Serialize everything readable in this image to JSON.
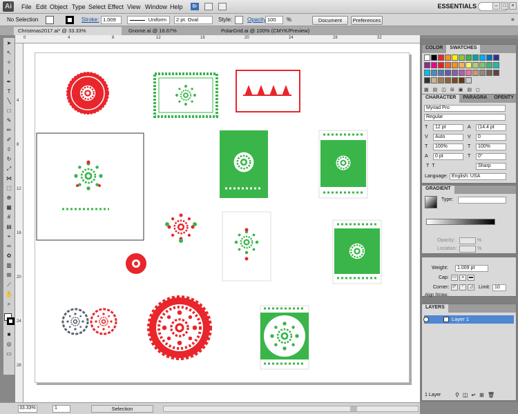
{
  "app": {
    "logo": "Ai",
    "workspace": "ESSENTIALS"
  },
  "menus": [
    "File",
    "Edit",
    "Object",
    "Type",
    "Select",
    "Effect",
    "View",
    "Window",
    "Help"
  ],
  "control_bar": {
    "selection": "No Selection",
    "stroke_label": "Stroke:",
    "stroke_value": "1.009",
    "profile": "Uniform",
    "brush": "2 pt. Oval",
    "style_label": "Style:",
    "opacity_label": "Opacity:",
    "opacity_value": "100",
    "opacity_unit": "%",
    "doc_setup": "Document Setup",
    "preferences": "Preferences"
  },
  "tabs": [
    "Christmas2017.ai* @ 33.33% (CMYK/Preview)",
    "Gnome.ai @ 16.67% (CMYK/Preview)",
    "PolarGrid.ai @ 100% (CMYK/Preview)"
  ],
  "ruler_top": [
    "0",
    "4",
    "8",
    "12",
    "16",
    "20",
    "24",
    "28",
    "32",
    "36"
  ],
  "ruler_left": [
    "4",
    "8",
    "12",
    "16",
    "20",
    "24",
    "28",
    "32"
  ],
  "status": {
    "zoom": "33.33%",
    "page": "1",
    "tool": "Selection"
  },
  "swatches_panel": {
    "tabs": [
      "COLOR",
      "SWATCHES"
    ]
  },
  "character_panel": {
    "tabs": [
      "CHARACTER",
      "PARAGRA",
      "OPENTY"
    ],
    "font": "Myriad Pro",
    "style": "Regular",
    "size": "12 pt",
    "leading": "(14.4 pt",
    "kerning": "Auto",
    "tracking": "0",
    "vscale": "100%",
    "hscale": "100%",
    "baseline": "0 pt",
    "rotation": "0°",
    "antialias": "Sharp",
    "language_label": "Language:",
    "language": "English: USA"
  },
  "gradient_panel": {
    "title": "GRADIENT",
    "type_label": "Type:",
    "opacity_label": "Opacity:",
    "location_label": "Location:",
    "pct": "%"
  },
  "stroke_panel": {
    "weight_label": "Weight:",
    "weight": "1.009 pt",
    "cap_label": "Cap:",
    "corner_label": "Corner:",
    "limit_label": "Limit:",
    "limit": "10",
    "align_label": "Align Stroke:"
  },
  "layers_panel": {
    "title": "LAYERS",
    "layer": "Layer 1",
    "count": "1 Layer"
  },
  "colors": {
    "red": "#e8262c",
    "green": "#3ab54a",
    "grey": "#5a6470"
  }
}
